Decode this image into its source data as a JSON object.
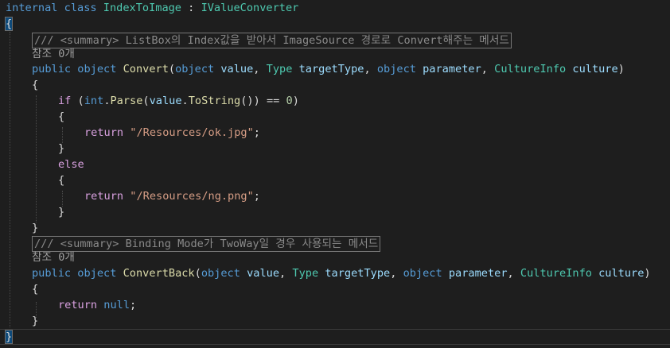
{
  "code": {
    "l1": {
      "kw1": "internal",
      "kw2": "class",
      "cls": "IndexToImage",
      "colon": " : ",
      "iface": "IValueConverter"
    },
    "l2": {
      "brace": "{"
    },
    "l3": {
      "slashes": "///",
      "tag": "<summary>",
      "text": "ListBox의 Index값을 받아서 ImageSource 경로로 Convert해주는 메서드"
    },
    "l4": {
      "refs": "참조 0개"
    },
    "l5": {
      "kw_public": "public",
      "kw_object": "object",
      "name": "Convert",
      "p1_type": "object",
      "p1_name": "value",
      "p2_type": "Type",
      "p2_name": "targetType",
      "p3_type": "object",
      "p3_name": "parameter",
      "p4_type": "CultureInfo",
      "p4_name": "culture"
    },
    "l6": {
      "brace": "{"
    },
    "l7": {
      "kw_if": "if",
      "kw_int": "int",
      "parse": "Parse",
      "arg": "value",
      "tostring": "ToString",
      "op": "==",
      "num": "0"
    },
    "l8": {
      "brace": "{"
    },
    "l9": {
      "kw_return": "return",
      "str": "\"/Resources/ok.jpg\""
    },
    "l10": {
      "brace": "}"
    },
    "l11": {
      "kw_else": "else"
    },
    "l12": {
      "brace": "{"
    },
    "l13": {
      "kw_return": "return",
      "str": "\"/Resources/ng.png\""
    },
    "l14": {
      "brace": "}"
    },
    "l15": {
      "brace": "}"
    },
    "l16": {
      "slashes": "///",
      "tag": "<summary>",
      "text": "Binding Mode가 TwoWay일 경우 사용되는 메서드"
    },
    "l17": {
      "refs": "참조 0개"
    },
    "l18": {
      "kw_public": "public",
      "kw_object": "object",
      "name": "ConvertBack",
      "p1_type": "object",
      "p1_name": "value",
      "p2_type": "Type",
      "p2_name": "targetType",
      "p3_type": "object",
      "p3_name": "parameter",
      "p4_type": "CultureInfo",
      "p4_name": "culture"
    },
    "l19": {
      "brace": "{"
    },
    "l20": {
      "kw_return": "return",
      "kw_null": "null"
    },
    "l21": {
      "brace": "}"
    },
    "l22": {
      "brace": "}"
    }
  },
  "colors": {
    "background": "#1e1e1e",
    "keyword": "#569cd6",
    "type": "#4ec9b0",
    "method": "#dcdcaa",
    "parameter": "#9cdcfe",
    "string": "#d69d85",
    "number": "#b5cea8",
    "comment": "#57a64a",
    "control_flow": "#d8a0df"
  }
}
